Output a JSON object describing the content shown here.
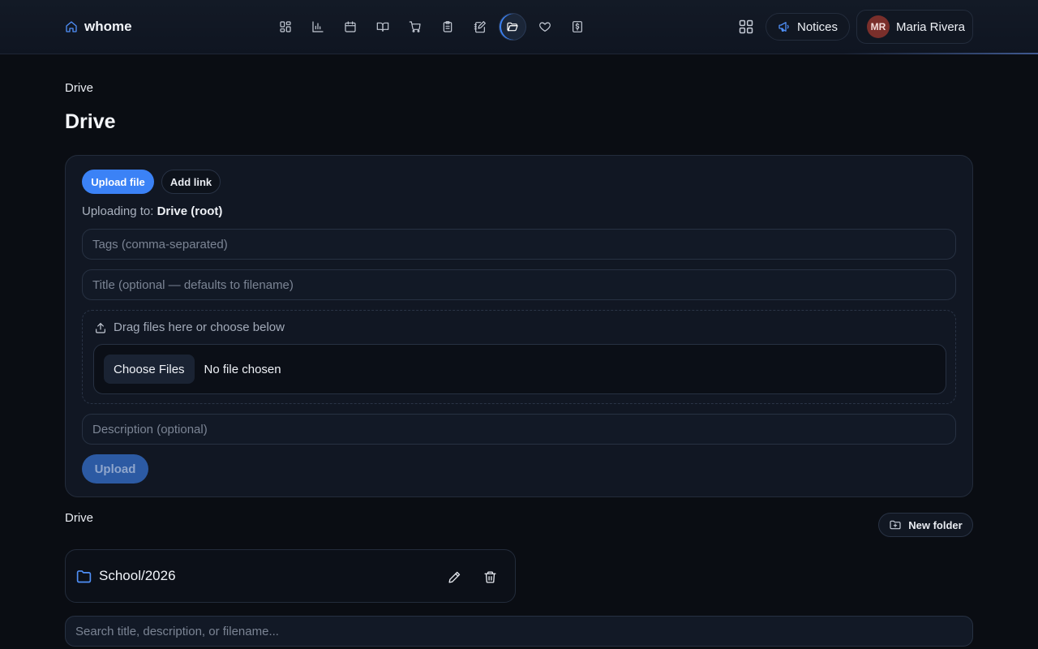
{
  "header": {
    "brand": "whome",
    "nav_icons": [
      "dashboard-icon",
      "chart-icon",
      "calendar-icon",
      "book-icon",
      "cart-icon",
      "clipboard-icon",
      "notebook-icon",
      "folder-icon",
      "heart-icon",
      "budget-icon"
    ],
    "active_nav": "folder-icon",
    "notices_label": "Notices",
    "user": {
      "initials": "MR",
      "name": "Maria Rivera"
    }
  },
  "breadcrumb": "Drive",
  "page_title": "Drive",
  "upload_panel": {
    "tabs": [
      "Upload file",
      "Add link"
    ],
    "uploading_to_label": "Uploading to:",
    "uploading_to_value": "Drive (root)",
    "tags_placeholder": "Tags (comma-separated)",
    "title_placeholder": "Title (optional — defaults to filename)",
    "drop_hint": "Drag files here or choose below",
    "choose_files_label": "Choose Files",
    "no_file_text": "No file chosen",
    "description_placeholder": "Description (optional)",
    "upload_label": "Upload"
  },
  "folders_section": {
    "label": "Drive",
    "new_folder_label": "New folder",
    "folders": [
      {
        "name": "School/2026"
      }
    ]
  },
  "search": {
    "placeholder": "Search title, description, or filename..."
  },
  "colors": {
    "accent": "#3b82f6",
    "background": "#0a0d13",
    "card": "#111723",
    "avatar": "#7a2f2b"
  }
}
